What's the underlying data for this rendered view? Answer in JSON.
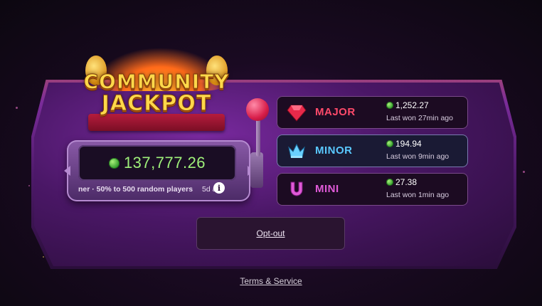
{
  "logo": {
    "line1": "COMMUNITY",
    "line2": "JACKPOT"
  },
  "jackpot": {
    "amount": "137,777.26",
    "description": "ner · 50% to 500 random players",
    "days": "5d a",
    "info_icon": "info-icon"
  },
  "tiers": [
    {
      "name": "MAJOR",
      "amount": "1,252.27",
      "last_won": "Last won 27min ago",
      "icon": "ruby-icon",
      "color": "#ff4a6a"
    },
    {
      "name": "MINOR",
      "amount": "194.94",
      "last_won": "Last won 9min ago",
      "icon": "crown-icon",
      "color": "#5ac8ff"
    },
    {
      "name": "MINI",
      "amount": "27.38",
      "last_won": "Last won 1min ago",
      "icon": "horseshoe-icon",
      "color": "#e05ad8"
    }
  ],
  "buttons": {
    "optout": "Opt-out",
    "terms": "Terms & Service"
  },
  "colors": {
    "coin": "#4ec23a",
    "amount_green": "#9ff07a",
    "panel": "#4e1a6a"
  }
}
